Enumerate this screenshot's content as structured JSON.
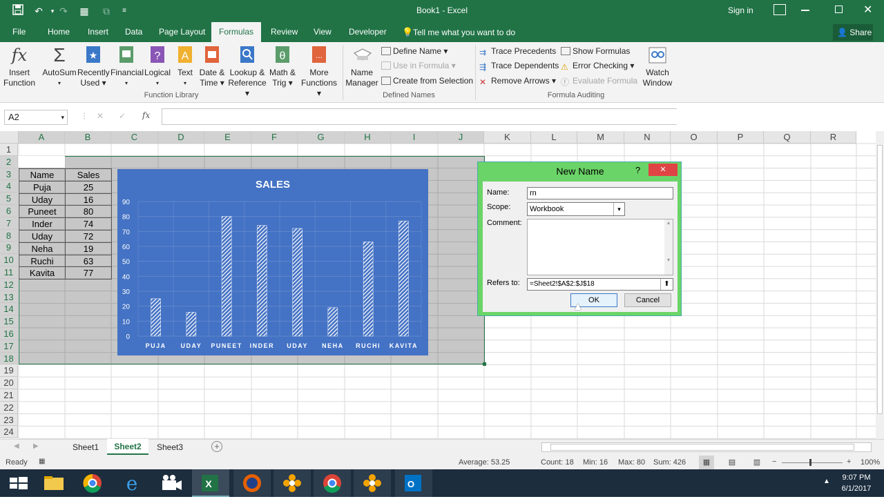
{
  "window": {
    "title": "Book1 - Excel",
    "sign_in": "Sign in"
  },
  "tabs": [
    "File",
    "Home",
    "Insert",
    "Data",
    "Page Layout",
    "Formulas",
    "Review",
    "View",
    "Developer"
  ],
  "tell_me": "Tell me what you want to do",
  "share": "Share",
  "ribbon": {
    "insert_function": [
      "Insert",
      "Function"
    ],
    "autosum": "AutoSum",
    "recently_used": [
      "Recently",
      "Used"
    ],
    "financial": "Financial",
    "logical": "Logical",
    "text": "Text",
    "date_time": [
      "Date &",
      "Time"
    ],
    "lookup": [
      "Lookup &",
      "Reference"
    ],
    "math": [
      "Math &",
      "Trig"
    ],
    "more": [
      "More",
      "Functions"
    ],
    "group_function_library": "Function Library",
    "name_manager": [
      "Name",
      "Manager"
    ],
    "define_name": "Define Name",
    "use_in_formula": "Use in Formula",
    "create_from_selection": "Create from Selection",
    "group_defined_names": "Defined Names",
    "trace_precedents": "Trace Precedents",
    "trace_dependents": "Trace Dependents",
    "remove_arrows": "Remove Arrows",
    "show_formulas": "Show Formulas",
    "error_checking": "Error Checking",
    "evaluate_formula": "Evaluate Formula",
    "watch_window": [
      "Watch",
      "Window"
    ],
    "group_formula_auditing": "Formula Auditing"
  },
  "formula_bar": {
    "name_box": "A2",
    "fx": "fx"
  },
  "columns": [
    "A",
    "B",
    "C",
    "D",
    "E",
    "F",
    "G",
    "H",
    "I",
    "J",
    "K",
    "L",
    "M",
    "N",
    "O",
    "P",
    "Q",
    "R"
  ],
  "rows": [
    "1",
    "2",
    "3",
    "4",
    "5",
    "6",
    "7",
    "8",
    "9",
    "10",
    "11",
    "12",
    "13",
    "14",
    "15",
    "16",
    "17",
    "18",
    "19",
    "20",
    "21",
    "22",
    "23",
    "24"
  ],
  "table": {
    "headers": [
      "Name",
      "Sales"
    ],
    "rows": [
      [
        "Puja",
        "25"
      ],
      [
        "Uday",
        "16"
      ],
      [
        "Puneet",
        "80"
      ],
      [
        "Inder",
        "74"
      ],
      [
        "Uday",
        "72"
      ],
      [
        "Neha",
        "19"
      ],
      [
        "Ruchi",
        "63"
      ],
      [
        "Kavita",
        "77"
      ]
    ]
  },
  "chart_data": {
    "type": "bar",
    "title": "SALES",
    "categories": [
      "PUJA",
      "UDAY",
      "PUNEET",
      "INDER",
      "UDAY",
      "NEHA",
      "RUCHI",
      "KAVITA"
    ],
    "values": [
      25,
      16,
      80,
      74,
      72,
      19,
      63,
      77
    ],
    "ylim": [
      0,
      90
    ],
    "yticks": [
      "0",
      "10",
      "20",
      "30",
      "40",
      "50",
      "60",
      "70",
      "80",
      "90"
    ],
    "background": "#4472c4",
    "bar_pattern": "diagonal-hatch-white"
  },
  "dialog": {
    "title": "New Name",
    "name_label": "Name:",
    "name_value": "rn",
    "scope_label": "Scope:",
    "scope_value": "Workbook",
    "comment_label": "Comment:",
    "refers_label": "Refers to:",
    "refers_value": "=Sheet2!$A$2:$J$18",
    "ok": "OK",
    "cancel": "Cancel",
    "help": "?",
    "close": "✕"
  },
  "sheets": [
    "Sheet1",
    "Sheet2",
    "Sheet3"
  ],
  "status": {
    "ready": "Ready",
    "average": "Average: 53.25",
    "count": "Count: 18",
    "min": "Min: 16",
    "max": "Max: 80",
    "sum": "Sum: 426",
    "zoom": "100%"
  },
  "clock": {
    "time": "9:07 PM",
    "date": "6/1/2017"
  },
  "colors": {
    "excel_green": "#217346",
    "chart_blue": "#4472c4",
    "dialog_border": "#6bd468"
  }
}
